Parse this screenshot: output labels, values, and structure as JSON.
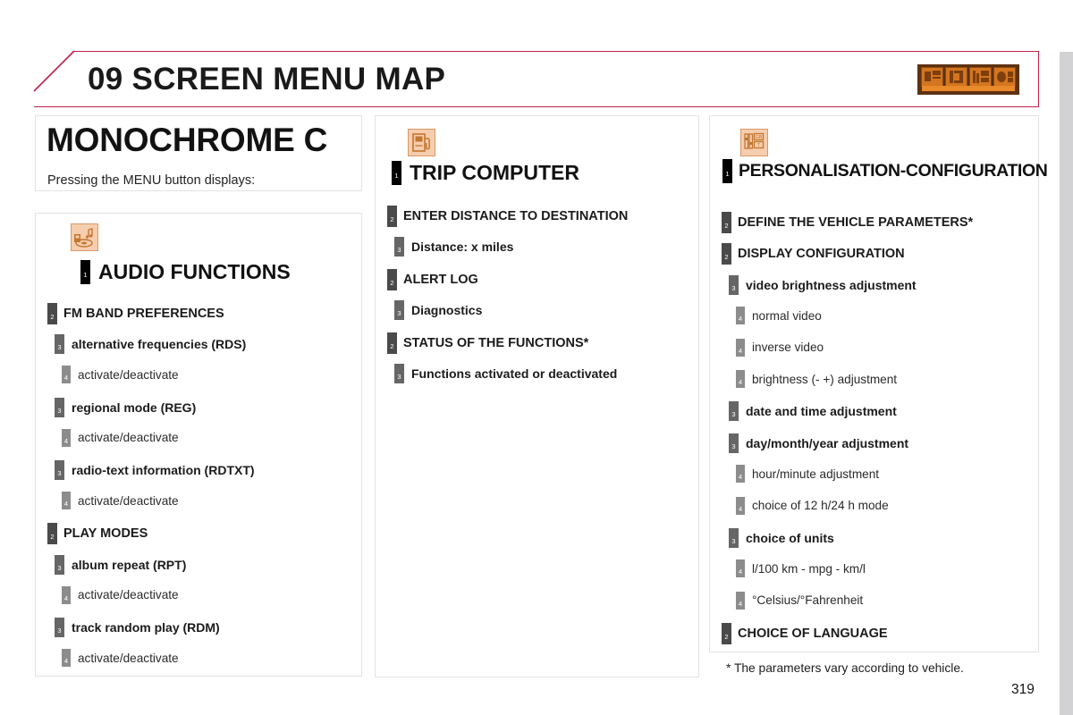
{
  "page": {
    "number": "319",
    "footnote": "* The parameters vary according to vehicle."
  },
  "header": {
    "title": "09 SCREEN MENU MAP",
    "accent_color": "#c2224a",
    "icon_name": "menu-map-tabs-icon",
    "icon_bg_color": "#5d3112",
    "icon_tile_color": "#d4751f"
  },
  "monochrome": {
    "title": "MONOCHROME C",
    "subtitle": "Pressing the MENU button displays:"
  },
  "columns": [
    {
      "id": "audio",
      "icon_name": "audio-radio-icon",
      "heading": "AUDIO FUNCTIONS",
      "items": [
        {
          "level": 2,
          "text": "FM BAND PREFERENCES"
        },
        {
          "level": 3,
          "text": "alternative frequencies (RDS)"
        },
        {
          "level": 4,
          "text": "activate/deactivate"
        },
        {
          "level": 3,
          "text": "regional mode (REG)"
        },
        {
          "level": 4,
          "text": "activate/deactivate"
        },
        {
          "level": 3,
          "text": "radio-text information (RDTXT)"
        },
        {
          "level": 4,
          "text": "activate/deactivate"
        },
        {
          "level": 2,
          "text": "PLAY MODES"
        },
        {
          "level": 3,
          "text": "album repeat (RPT)"
        },
        {
          "level": 4,
          "text": "activate/deactivate"
        },
        {
          "level": 3,
          "text": "track random play (RDM)"
        },
        {
          "level": 4,
          "text": "activate/deactivate"
        }
      ]
    },
    {
      "id": "trip",
      "icon_name": "fuel-pump-icon",
      "heading": "TRIP COMPUTER",
      "items": [
        {
          "level": 2,
          "text": "ENTER DISTANCE TO DESTINATION"
        },
        {
          "level": 3,
          "text": "Distance: x miles"
        },
        {
          "level": 2,
          "text": "ALERT LOG"
        },
        {
          "level": 3,
          "text": "Diagnostics"
        },
        {
          "level": 2,
          "text": "STATUS OF THE FUNCTIONS*"
        },
        {
          "level": 3,
          "text": "Functions activated or deactivated"
        }
      ]
    },
    {
      "id": "personalisation",
      "icon_name": "personalisation-settings-icon",
      "heading": "PERSONALISATION-CONFIGURATION",
      "items": [
        {
          "level": 2,
          "text": "DEFINE THE VEHICLE PARAMETERS*"
        },
        {
          "level": 2,
          "text": "DISPLAY CONFIGURATION"
        },
        {
          "level": 3,
          "text": "video brightness adjustment"
        },
        {
          "level": 4,
          "text": "normal video"
        },
        {
          "level": 4,
          "text": "inverse video"
        },
        {
          "level": 4,
          "text": "brightness (- +) adjustment"
        },
        {
          "level": 3,
          "text": "date and time adjustment"
        },
        {
          "level": 3,
          "text": "day/month/year adjustment"
        },
        {
          "level": 4,
          "text": "hour/minute adjustment"
        },
        {
          "level": 4,
          "text": "choice of 12 h/24 h mode"
        },
        {
          "level": 3,
          "text": "choice of units"
        },
        {
          "level": 4,
          "text": "l/100 km - mpg - km/l"
        },
        {
          "level": 4,
          "text": "°Celsius/°Fahrenheit"
        },
        {
          "level": 2,
          "text": "CHOICE OF LANGUAGE"
        }
      ]
    }
  ],
  "badge_labels": {
    "l1": "1",
    "l2": "2",
    "l3": "3",
    "l4": "4"
  }
}
